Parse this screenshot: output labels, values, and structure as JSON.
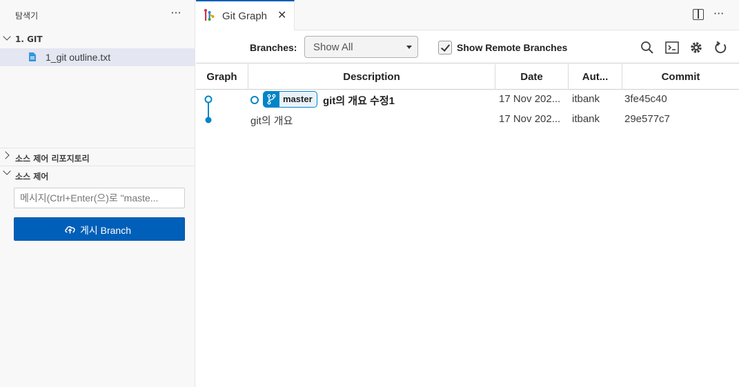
{
  "sidebar": {
    "title": "탐색기",
    "more": "···",
    "folder": "1. GIT",
    "file": "1_git outline.txt",
    "section_repos": "소스 제어 리포지토리",
    "section_scm": "소스 제어",
    "commit_placeholder": "메시지(Ctrl+Enter(으)로 \"maste...",
    "publish_label": "게시 Branch"
  },
  "tab": {
    "label": "Git Graph",
    "close": "✕",
    "more": "···"
  },
  "controls": {
    "branches_label": "Branches:",
    "branches_value": "Show All",
    "remote_label": "Show Remote Branches",
    "remote_checked": true
  },
  "table": {
    "columns": [
      "Graph",
      "Description",
      "Date",
      "Aut...",
      "Commit"
    ],
    "rows": [
      {
        "ref": "master",
        "message": "git의 개요 수정1",
        "date": "17 Nov 202...",
        "author": "itbank",
        "commit": "3fe45c40"
      },
      {
        "ref": "",
        "message": "git의 개요",
        "date": "17 Nov 202...",
        "author": "itbank",
        "commit": "29e577c7"
      }
    ]
  },
  "colors": {
    "accent": "#005fb8",
    "graph": "#0085c7",
    "selection": "#e4e6f1"
  }
}
